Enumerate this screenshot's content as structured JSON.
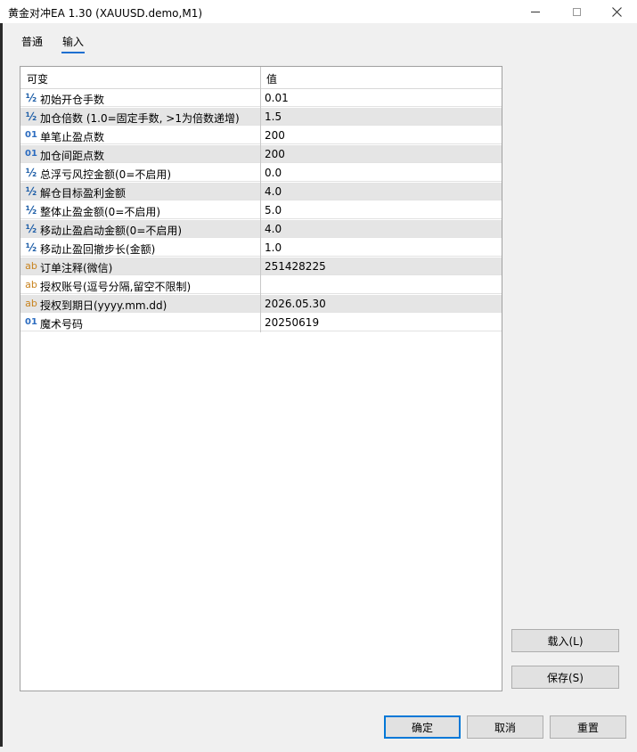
{
  "window": {
    "title": "黄金对冲EA 1.30 (XAUUSD.demo,M1)",
    "controls": [
      "minimize-icon",
      "maximize-icon",
      "close-icon"
    ]
  },
  "tabs": [
    {
      "label": "普通",
      "active": false
    },
    {
      "label": "输入",
      "active": true
    }
  ],
  "grid": {
    "headers": {
      "param": "可变",
      "value": "值"
    },
    "rows": [
      {
        "type": "double",
        "icon": "½",
        "name": "初始开仓手数",
        "value": "0.01"
      },
      {
        "type": "double",
        "icon": "½",
        "name": "加仓倍数 (1.0=固定手数, >1为倍数递增)",
        "value": "1.5"
      },
      {
        "type": "int",
        "icon": "01",
        "name": "单笔止盈点数",
        "value": "200"
      },
      {
        "type": "int",
        "icon": "01",
        "name": "加仓间距点数",
        "value": "200"
      },
      {
        "type": "double",
        "icon": "½",
        "name": "总浮亏风控金额(0=不启用)",
        "value": "0.0"
      },
      {
        "type": "double",
        "icon": "½",
        "name": "解仓目标盈利金额",
        "value": "4.0"
      },
      {
        "type": "double",
        "icon": "½",
        "name": "整体止盈金额(0=不启用)",
        "value": "5.0"
      },
      {
        "type": "double",
        "icon": "½",
        "name": "移动止盈启动金额(0=不启用)",
        "value": "4.0"
      },
      {
        "type": "double",
        "icon": "½",
        "name": "移动止盈回撤步长(金额)",
        "value": "1.0"
      },
      {
        "type": "string",
        "icon": "ab",
        "name": "订单注释(微信)",
        "value": "251428225"
      },
      {
        "type": "string",
        "icon": "ab",
        "name": "授权账号(逗号分隔,留空不限制)",
        "value": ""
      },
      {
        "type": "string",
        "icon": "ab",
        "name": "授权到期日(yyyy.mm.dd)",
        "value": "2026.05.30"
      },
      {
        "type": "int",
        "icon": "01",
        "name": "魔术号码",
        "value": "20250619"
      }
    ]
  },
  "side_buttons": {
    "load": "载入(L)",
    "save": "保存(S)"
  },
  "footer_buttons": {
    "ok": "确定",
    "cancel": "取消",
    "reset": "重置"
  },
  "colors": {
    "accent": "#0078d7",
    "double_icon": "#1f5fa8",
    "int_icon": "#2c6cc0",
    "string_icon": "#c8821c"
  }
}
